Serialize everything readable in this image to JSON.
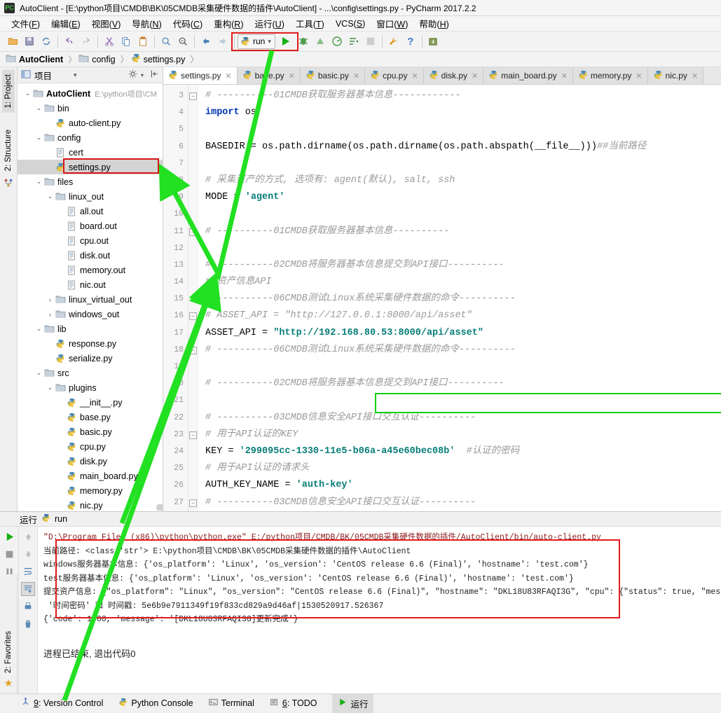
{
  "window": {
    "title": "AutoClient - [E:\\python项目\\CMDB\\BK\\05CMDB采集硬件数据的插件\\AutoClient] - ...\\config\\settings.py - PyCharm 2017.2.2",
    "app_icon": "pycharm-icon"
  },
  "menubar": [
    {
      "label": "文件",
      "key": "F"
    },
    {
      "label": "编辑",
      "key": "E"
    },
    {
      "label": "视图",
      "key": "V"
    },
    {
      "label": "导航",
      "key": "N"
    },
    {
      "label": "代码",
      "key": "C"
    },
    {
      "label": "重构",
      "key": "R"
    },
    {
      "label": "运行",
      "key": "U"
    },
    {
      "label": "工具",
      "key": "T"
    },
    {
      "label": "VCS",
      "key": "S"
    },
    {
      "label": "窗口",
      "key": "W"
    },
    {
      "label": "帮助",
      "key": "H"
    }
  ],
  "toolbar": {
    "run_config_label": "run",
    "icons": [
      "open-folder-icon",
      "save-all-icon",
      "sync-icon",
      "undo-icon",
      "redo-icon",
      "cut-icon",
      "copy-icon",
      "paste-icon",
      "find-icon",
      "replace-icon",
      "back-icon",
      "forward-icon"
    ],
    "right_icons": [
      "debug-icon",
      "coverage-icon",
      "profile-icon",
      "stop-icon",
      "grid-icon",
      "settings-wrench-icon",
      "help-icon",
      "update-project-icon"
    ]
  },
  "breadcrumb": [
    {
      "label": "AutoClient",
      "icon": "folder-icon",
      "bold": true
    },
    {
      "label": "config",
      "icon": "folder-icon",
      "bold": false
    },
    {
      "label": "settings.py",
      "icon": "python-file-icon",
      "bold": false
    }
  ],
  "left_tool_tabs": [
    {
      "label": "1: Project",
      "icon": "project-icon",
      "active": true
    },
    {
      "label": "2: Structure",
      "icon": "structure-icon",
      "active": false
    }
  ],
  "favorites_tab": {
    "label": "2: Favorites",
    "icon": "star-icon"
  },
  "project_panel": {
    "title": "项目",
    "header_icons": [
      "project-view-icon",
      "chevron-down-icon",
      "gear-icon",
      "collapse-all-icon"
    ],
    "tree": [
      {
        "depth": 0,
        "label": "AutoClient",
        "icon": "folder-icon",
        "arrow": "down",
        "bold": true,
        "path": "E:\\python项目\\CM"
      },
      {
        "depth": 1,
        "label": "bin",
        "icon": "folder-icon",
        "arrow": "down"
      },
      {
        "depth": 2,
        "label": "auto-client.py",
        "icon": "python-file-icon",
        "arrow": "none"
      },
      {
        "depth": 1,
        "label": "config",
        "icon": "folder-icon",
        "arrow": "down"
      },
      {
        "depth": 2,
        "label": "cert",
        "icon": "text-file-icon",
        "arrow": "none"
      },
      {
        "depth": 2,
        "label": "settings.py",
        "icon": "python-file-icon",
        "arrow": "none",
        "selected": true
      },
      {
        "depth": 1,
        "label": "files",
        "icon": "folder-icon",
        "arrow": "down"
      },
      {
        "depth": 2,
        "label": "linux_out",
        "icon": "folder-icon",
        "arrow": "down"
      },
      {
        "depth": 3,
        "label": "all.out",
        "icon": "text-file-icon",
        "arrow": "none"
      },
      {
        "depth": 3,
        "label": "board.out",
        "icon": "text-file-icon",
        "arrow": "none"
      },
      {
        "depth": 3,
        "label": "cpu.out",
        "icon": "text-file-icon",
        "arrow": "none"
      },
      {
        "depth": 3,
        "label": "disk.out",
        "icon": "text-file-icon",
        "arrow": "none"
      },
      {
        "depth": 3,
        "label": "memory.out",
        "icon": "text-file-icon",
        "arrow": "none"
      },
      {
        "depth": 3,
        "label": "nic.out",
        "icon": "text-file-icon",
        "arrow": "none"
      },
      {
        "depth": 2,
        "label": "linux_virtual_out",
        "icon": "folder-icon",
        "arrow": "right"
      },
      {
        "depth": 2,
        "label": "windows_out",
        "icon": "folder-icon",
        "arrow": "right"
      },
      {
        "depth": 1,
        "label": "lib",
        "icon": "folder-icon",
        "arrow": "down"
      },
      {
        "depth": 2,
        "label": "response.py",
        "icon": "python-file-icon",
        "arrow": "none"
      },
      {
        "depth": 2,
        "label": "serialize.py",
        "icon": "python-file-icon",
        "arrow": "none"
      },
      {
        "depth": 1,
        "label": "src",
        "icon": "folder-icon",
        "arrow": "down"
      },
      {
        "depth": 2,
        "label": "plugins",
        "icon": "folder-icon",
        "arrow": "down"
      },
      {
        "depth": 3,
        "label": "__init__.py",
        "icon": "python-file-icon",
        "arrow": "none"
      },
      {
        "depth": 3,
        "label": "base.py",
        "icon": "python-file-icon",
        "arrow": "none"
      },
      {
        "depth": 3,
        "label": "basic.py",
        "icon": "python-file-icon",
        "arrow": "none"
      },
      {
        "depth": 3,
        "label": "cpu.py",
        "icon": "python-file-icon",
        "arrow": "none"
      },
      {
        "depth": 3,
        "label": "disk.py",
        "icon": "python-file-icon",
        "arrow": "none"
      },
      {
        "depth": 3,
        "label": "main_board.py",
        "icon": "python-file-icon",
        "arrow": "none"
      },
      {
        "depth": 3,
        "label": "memory.py",
        "icon": "python-file-icon",
        "arrow": "none"
      },
      {
        "depth": 3,
        "label": "nic.py",
        "icon": "python-file-icon",
        "arrow": "none"
      }
    ]
  },
  "editor": {
    "tabs": [
      {
        "label": "settings.py",
        "active": true
      },
      {
        "label": "base.py",
        "active": false
      },
      {
        "label": "basic.py",
        "active": false
      },
      {
        "label": "cpu.py",
        "active": false
      },
      {
        "label": "disk.py",
        "active": false
      },
      {
        "label": "main_board.py",
        "active": false
      },
      {
        "label": "memory.py",
        "active": false
      },
      {
        "label": "nic.py",
        "active": false
      }
    ],
    "first_line_number": 3,
    "lines": [
      {
        "n": 3,
        "fold": "minus",
        "tokens": [
          {
            "t": "# ----------01CMDB获取服务器基本信息------------",
            "c": "com"
          }
        ]
      },
      {
        "n": 4,
        "fold": "",
        "tokens": [
          {
            "t": "import",
            "c": "kw"
          },
          {
            "t": " os",
            "c": "txt"
          }
        ]
      },
      {
        "n": 5,
        "fold": "",
        "tokens": []
      },
      {
        "n": 6,
        "fold": "",
        "tokens": [
          {
            "t": "BASEDIR = os.path.dirname(os.path.dirname(os.path.abspath(__file__)))",
            "c": "txt"
          },
          {
            "t": "##当前路径",
            "c": "com"
          }
        ]
      },
      {
        "n": 7,
        "fold": "",
        "tokens": []
      },
      {
        "n": 8,
        "fold": "",
        "tokens": [
          {
            "t": "# 采集资产的方式, 选项有: agent(默认), salt, ssh",
            "c": "com"
          }
        ]
      },
      {
        "n": 9,
        "fold": "",
        "tokens": [
          {
            "t": "MODE = ",
            "c": "txt"
          },
          {
            "t": "'agent'",
            "c": "str"
          }
        ]
      },
      {
        "n": 10,
        "fold": "",
        "tokens": []
      },
      {
        "n": 11,
        "fold": "minus",
        "tokens": [
          {
            "t": "# ----------01CMDB获取服务器基本信息----------",
            "c": "com"
          }
        ]
      },
      {
        "n": 12,
        "fold": "",
        "tokens": []
      },
      {
        "n": 13,
        "fold": "",
        "tokens": [
          {
            "t": "# ----------02CMDB将服务器基本信息提交到API接口----------",
            "c": "com"
          }
        ]
      },
      {
        "n": 14,
        "fold": "",
        "tokens": [
          {
            "t": "# 资产信息API",
            "c": "com"
          }
        ]
      },
      {
        "n": 15,
        "fold": "",
        "tokens": [
          {
            "t": "# ----------06CMDB测试Linux系统采集硬件数据的命令----------",
            "c": "com"
          }
        ]
      },
      {
        "n": 16,
        "fold": "minus",
        "tokens": [
          {
            "t": "# ASSET_API = \"http://127.0.0.1:8000/api/asset\"",
            "c": "com"
          }
        ]
      },
      {
        "n": 17,
        "fold": "",
        "tokens": [
          {
            "t": "ASSET_API = ",
            "c": "txt"
          },
          {
            "t": "\"http://192.168.80.53:8000/api/asset\"",
            "c": "str"
          }
        ]
      },
      {
        "n": 18,
        "fold": "minus",
        "tokens": [
          {
            "t": "# ----------06CMDB测试Linux系统采集硬件数据的命令----------",
            "c": "com"
          }
        ]
      },
      {
        "n": 19,
        "fold": "",
        "tokens": []
      },
      {
        "n": 20,
        "fold": "",
        "tokens": [
          {
            "t": "# ----------02CMDB将服务器基本信息提交到API接口----------",
            "c": "com"
          }
        ]
      },
      {
        "n": 21,
        "fold": "",
        "tokens": []
      },
      {
        "n": 22,
        "fold": "",
        "tokens": [
          {
            "t": "# ----------03CMDB信息安全API接口交互认证----------",
            "c": "com"
          }
        ]
      },
      {
        "n": 23,
        "fold": "minus",
        "tokens": [
          {
            "t": "# 用于API认证的KEY",
            "c": "com"
          }
        ]
      },
      {
        "n": 24,
        "fold": "",
        "tokens": [
          {
            "t": "KEY = ",
            "c": "txt"
          },
          {
            "t": "'299095cc-1330-11e5-b06a-a45e60bec08b'",
            "c": "str"
          },
          {
            "t": "  #认证的密码",
            "c": "com"
          }
        ]
      },
      {
        "n": 25,
        "fold": "",
        "tokens": [
          {
            "t": "# 用于API认证的请求头",
            "c": "com"
          }
        ]
      },
      {
        "n": 26,
        "fold": "",
        "tokens": [
          {
            "t": "AUTH_KEY_NAME = ",
            "c": "txt"
          },
          {
            "t": "'auth-key'",
            "c": "str"
          }
        ]
      },
      {
        "n": 27,
        "fold": "minus",
        "tokens": [
          {
            "t": "# ----------03CMDB信息安全API接口交互认证----------",
            "c": "com"
          }
        ]
      }
    ]
  },
  "run_panel": {
    "title": "运行",
    "config_label": "run",
    "tool_icons": [
      "rerun-icon",
      "stop-icon",
      "pause-icon",
      "print-output-icon",
      "debug-attach-icon",
      "close-icon",
      "help-icon"
    ],
    "tool_icons2": [
      "scroll-up-icon",
      "scroll-down-icon",
      "soft-wrap-icon",
      "scroll-to-end-icon",
      "print-icon",
      "trash-icon"
    ],
    "console_lines": [
      {
        "text": "\"D:\\Program Files (x86)\\python\\python.exe\" E:/python项目/CMDB/BK/05CMDB采集硬件数据的插件/AutoClient/bin/auto-client.py",
        "cmd": true
      },
      {
        "text": "当前路径: <class 'str'> E:\\python项目\\CMDB\\BK\\05CMDB采集硬件数据的插件\\AutoClient",
        "cmd": false
      },
      {
        "text": "windows服务器基本信息: {'os_platform': 'Linux', 'os_version': 'CentOS release 6.6 (Final)', 'hostname': 'test.com'}",
        "cmd": false
      },
      {
        "text": "test服务器基本信息: {'os_platform': 'Linux', 'os_version': 'CentOS release 6.6 (Final)', 'hostname': 'test.com'}",
        "cmd": false
      },
      {
        "text": "提交资产信息: {\"os_platform\": \"Linux\", \"os_version\": \"CentOS release 6.6 (Final)\", \"hostname\": \"DKL18U83RFAQI3G\", \"cpu\": {\"status\": true, \"message\": null, \"d",
        "cmd": false
      },
      {
        "text": " '时间密码' 和 时间戳: 5e6b9e7911349f19f833cd829a9d46af|1530520917.526367",
        "cmd": false
      },
      {
        "text": "{'code': 1000, 'message': '[DKL18U83RFAQI3G]更新完成'}",
        "cmd": false
      },
      {
        "text": "",
        "cmd": false
      },
      {
        "text": "进程已结束, 退出代码0",
        "cmd": false,
        "font": "sans"
      }
    ]
  },
  "statusbar": [
    {
      "label": "9: Version Control",
      "icon": "version-control-icon",
      "underline": "9",
      "active": false
    },
    {
      "label": "Python Console",
      "icon": "python-icon",
      "underline": "",
      "active": false
    },
    {
      "label": "Terminal",
      "icon": "terminal-icon",
      "underline": "",
      "active": false
    },
    {
      "label": "6: TODO",
      "icon": "todo-icon",
      "underline": "6",
      "active": false
    },
    {
      "label": "运行",
      "icon": "run-play-icon",
      "underline": "",
      "active": true
    }
  ],
  "annotations": {
    "highlight_color_red": "#e01b1b",
    "highlight_color_green": "#11d011",
    "arrow_color": "#22e022"
  }
}
